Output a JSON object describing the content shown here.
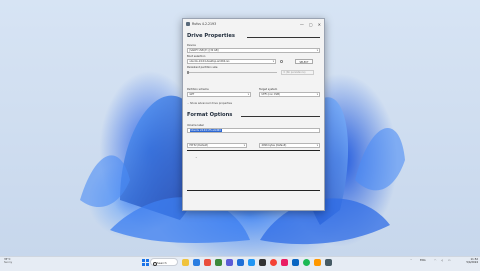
{
  "window": {
    "title": "Rufus 4.2.2193",
    "controls": {
      "minimize": "—",
      "maximize": "▢",
      "close": "✕"
    }
  },
  "drive_properties": {
    "heading": "Drive Properties",
    "device_label": "Device",
    "device_value": "JSARPY USB (E:) [30 GB]",
    "boot_label": "Boot selection",
    "boot_value": "ubuntu-24.04-desktop-amd64.iso",
    "select_button": "SELECT",
    "persistent_label": "Persistent partition size",
    "persistent_value": "0 (No persistence)",
    "persistent_fraction": 0.0,
    "partition_label": "Partition scheme",
    "partition_value": "GPT",
    "target_label": "Target system",
    "target_value": "UEFI (non CSM)",
    "advanced_toggle": "Show advanced drive properties"
  },
  "format_options": {
    "heading": "Format Options",
    "volume_label": "Volume label",
    "volume_value": "Ubuntu 24.04 LTS amd64",
    "fs_value": "FAT32 (Default)",
    "cluster_value": "4096 bytes (Default)"
  },
  "taskbar": {
    "weather_temp": "35°C",
    "weather_desc": "Sunny",
    "search_placeholder": "Search",
    "lang": "ENG",
    "time": "11:52",
    "date": "5/4/2024"
  }
}
